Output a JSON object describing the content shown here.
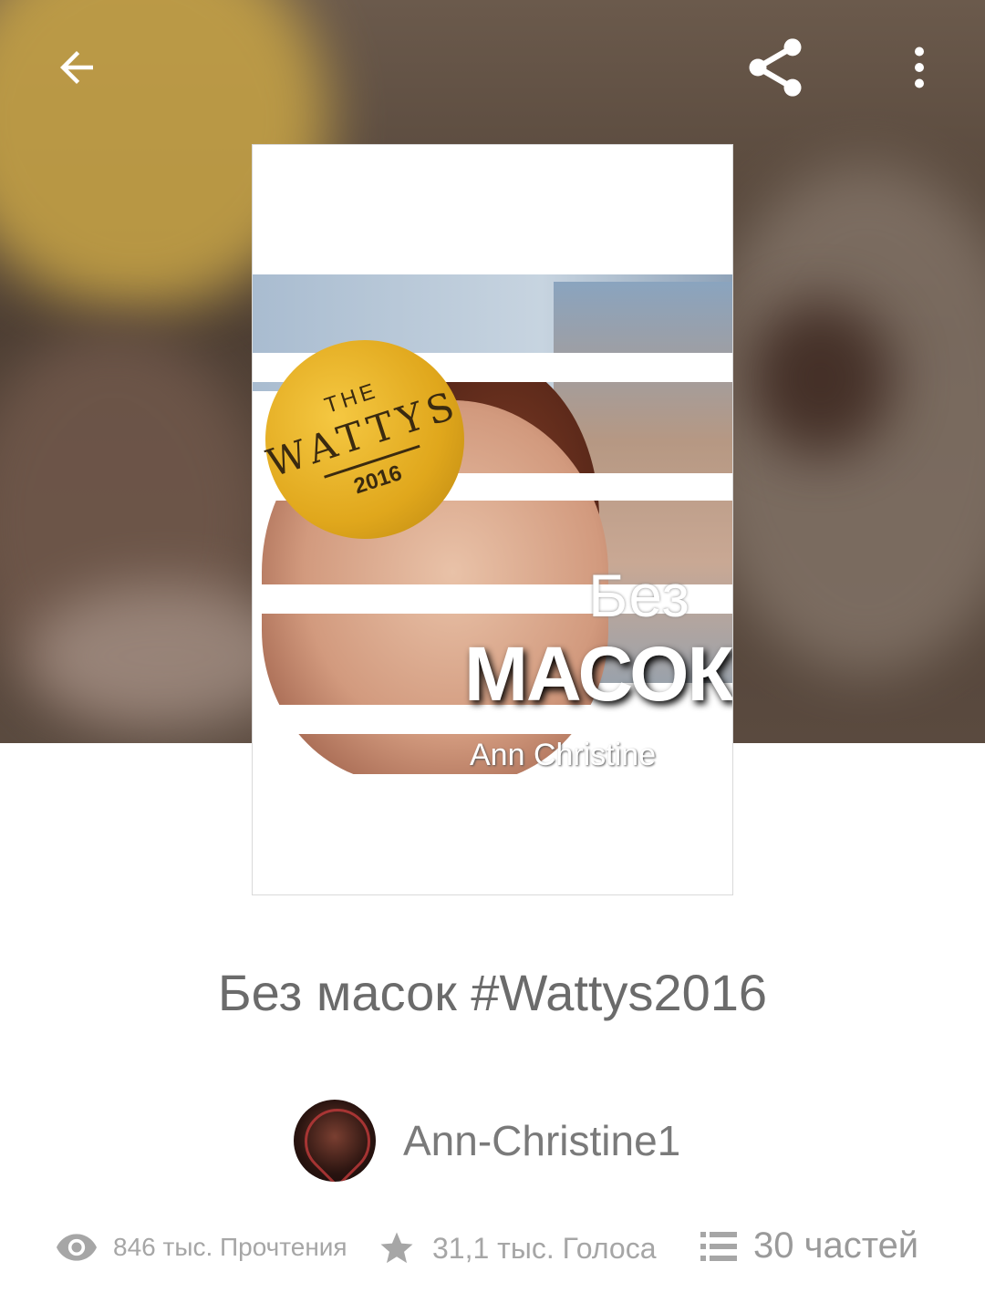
{
  "header": {
    "back_icon": "arrow-left-icon",
    "share_icon": "share-icon",
    "more_icon": "more-vertical-icon"
  },
  "cover": {
    "badge_the": "THE",
    "badge_wattys": "WATTYS",
    "badge_year": "2016",
    "title_line1": "Без",
    "title_line2": "МАСОК",
    "author": "Ann Christine"
  },
  "story": {
    "title": "Без масок #Wattys2016",
    "author_name": "Ann-Christine1"
  },
  "stats": {
    "reads": "846 тыс. Прочтения",
    "votes": "31,1 тыс. Голоса",
    "parts": "30 частей"
  },
  "colors": {
    "text_gray": "#6b6b6b",
    "stat_gray": "#a6a6a6",
    "badge_gold": "#e0a71c"
  }
}
